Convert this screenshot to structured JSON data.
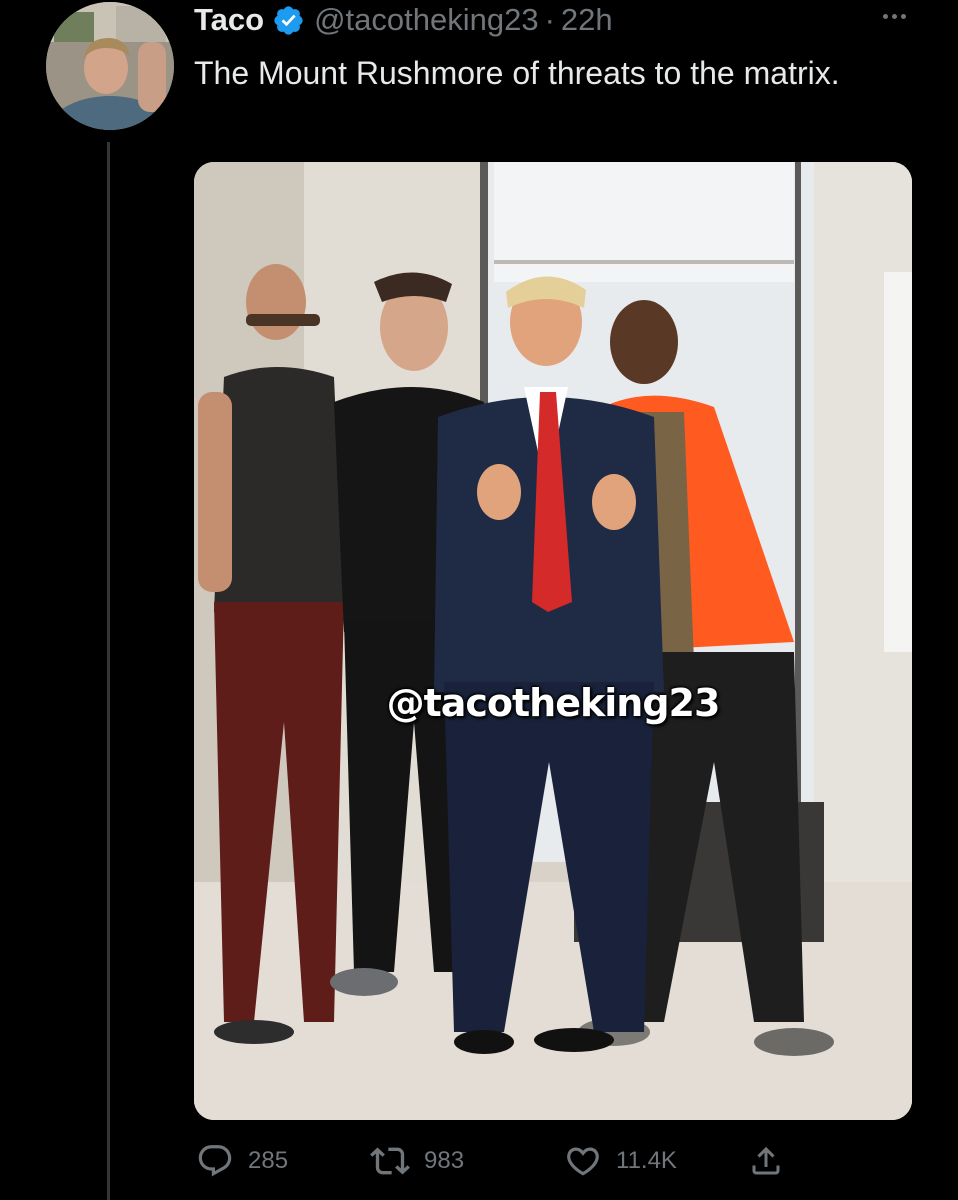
{
  "tweet": {
    "display_name": "Taco",
    "handle": "@tacotheking23",
    "separator": "·",
    "time": "22h",
    "text": "The Mount Rushmore of threats to the matrix.",
    "media": {
      "watermark": "@tacotheking23"
    },
    "actions": {
      "replies": "285",
      "retweets": "983",
      "likes": "11.4K"
    }
  },
  "colors": {
    "background": "#000000",
    "text": "#e7e9ea",
    "secondary": "#71767b",
    "verified": "#1d9bf0",
    "thread_line": "#333639"
  },
  "icons": {
    "verified": "verified-badge-icon",
    "more": "more-options-icon",
    "reply": "reply-icon",
    "retweet": "retweet-icon",
    "like": "heart-icon",
    "share": "share-icon"
  }
}
